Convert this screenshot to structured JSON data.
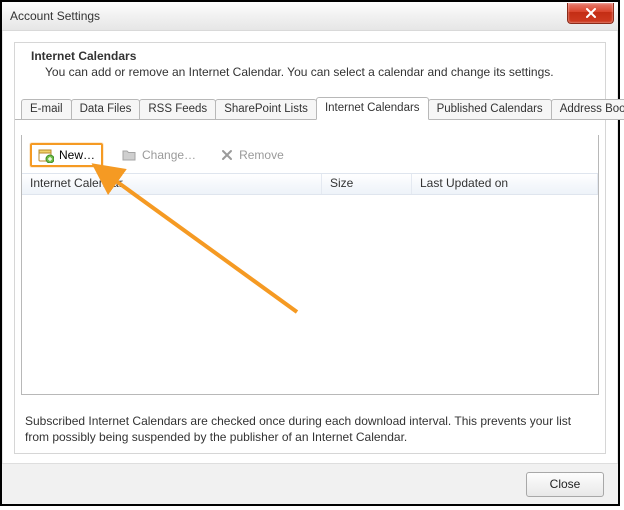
{
  "window": {
    "title": "Account Settings",
    "close_tooltip": "Close"
  },
  "heading": {
    "title": "Internet Calendars",
    "subtitle": "You can add or remove an Internet Calendar. You can select a calendar and change its settings."
  },
  "tabs": [
    {
      "label": "E-mail"
    },
    {
      "label": "Data Files"
    },
    {
      "label": "RSS Feeds"
    },
    {
      "label": "SharePoint Lists"
    },
    {
      "label": "Internet Calendars",
      "active": true
    },
    {
      "label": "Published Calendars"
    },
    {
      "label": "Address Books"
    }
  ],
  "toolbar": {
    "new_label": "New…",
    "change_label": "Change…",
    "remove_label": "Remove"
  },
  "columns": {
    "name": "Internet Calendar",
    "size": "Size",
    "last": "Last Updated on"
  },
  "rows": [],
  "note": "Subscribed Internet Calendars are checked once during each download interval. This prevents your list from possibly being suspended by the publisher of an Internet Calendar.",
  "footer": {
    "close_label": "Close"
  }
}
